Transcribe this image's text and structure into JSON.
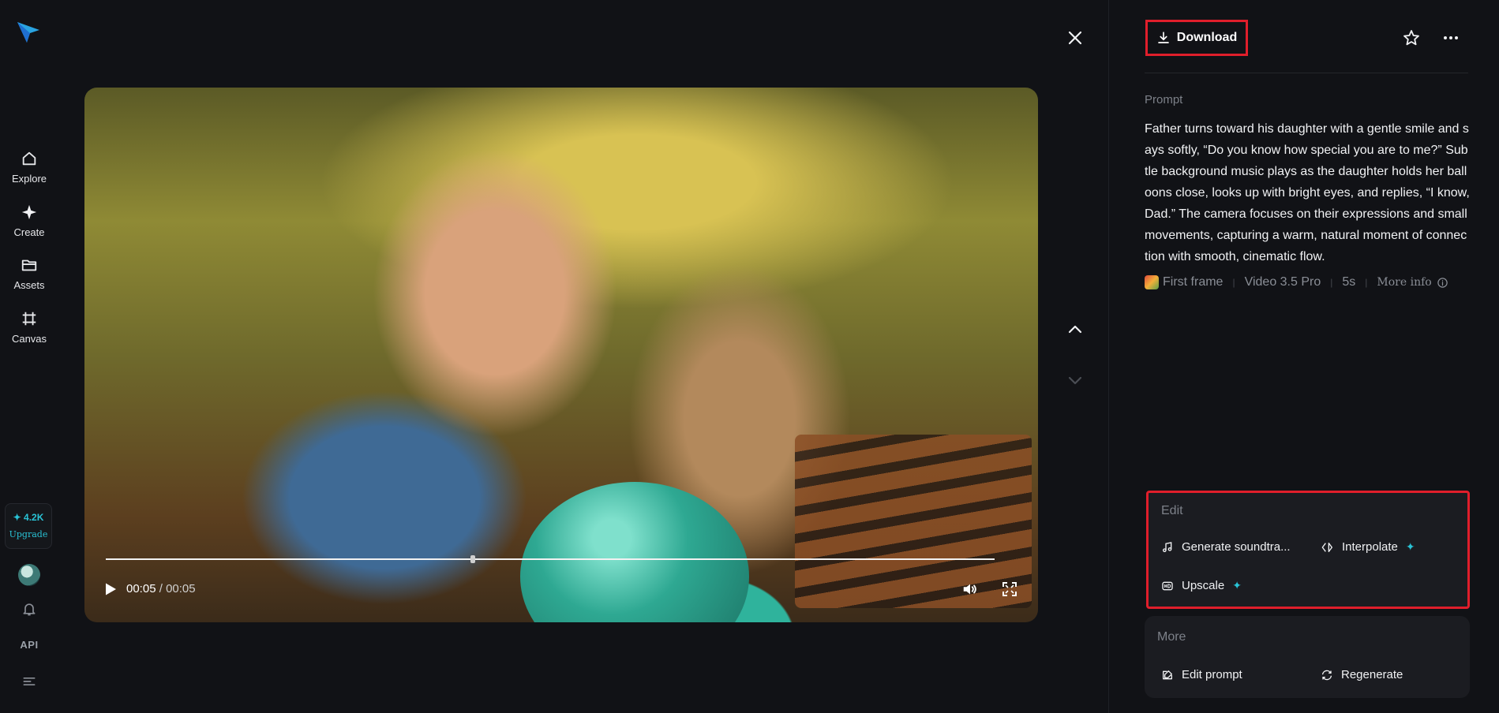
{
  "sidebar": {
    "nav": [
      {
        "label": "Explore",
        "icon": "home-icon"
      },
      {
        "label": "Create",
        "icon": "sparkle-icon"
      },
      {
        "label": "Assets",
        "icon": "folder-icon"
      },
      {
        "label": "Canvas",
        "icon": "canvas-grid-icon"
      }
    ],
    "credits": {
      "amount": "✦ 4.2K",
      "upgrade": "Upgrade"
    },
    "api_label": "API"
  },
  "player": {
    "current_time": "00:05",
    "separator": " / ",
    "duration": "00:05",
    "progress_fraction": 0.41
  },
  "panel": {
    "download_label": "Download",
    "prompt_label": "Prompt",
    "prompt_text": "Father turns toward his daughter with a gentle smile and says softly, “Do you know how special you are to me?” Subtle background music plays as the daughter holds her balloons close, looks up with bright eyes, and replies, “I know, Dad.” The camera focuses on their expressions and small movements, capturing a warm, natural moment of connection with smooth, cinematic flow.",
    "meta": {
      "first_frame": "First frame",
      "model": "Video 3.5 Pro",
      "duration": "5s",
      "more_info": "More info"
    },
    "edit": {
      "title": "Edit",
      "generate_soundtrack": "Generate soundtra...",
      "interpolate": "Interpolate",
      "upscale": "Upscale",
      "spark": "✦"
    },
    "more": {
      "title": "More",
      "edit_prompt": "Edit prompt",
      "regenerate": "Regenerate"
    }
  },
  "colors": {
    "accent": "#29c3d6",
    "highlight_box": "#e01e2b",
    "background": "#111216"
  }
}
